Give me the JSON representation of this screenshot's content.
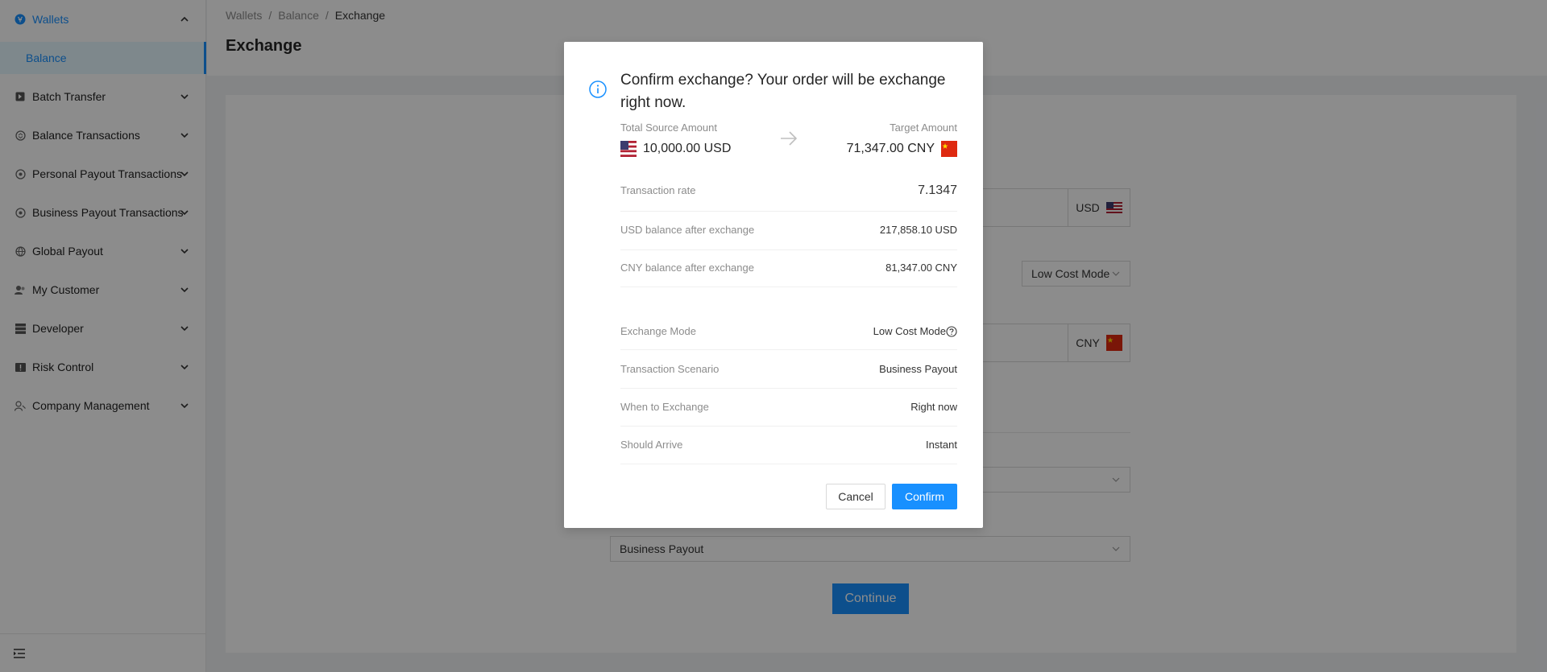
{
  "sidebar": {
    "items": [
      {
        "label": "Wallets",
        "icon": "wallet-icon",
        "expanded": true
      },
      {
        "label": "Batch Transfer",
        "icon": "batch-transfer-icon"
      },
      {
        "label": "Balance Transactions",
        "icon": "balance-transactions-icon"
      },
      {
        "label": "Personal Payout Transactions",
        "icon": "personal-payout-icon"
      },
      {
        "label": "Business Payout Transactions",
        "icon": "business-payout-icon"
      },
      {
        "label": "Global Payout",
        "icon": "global-payout-icon"
      },
      {
        "label": "My Customer",
        "icon": "customer-icon"
      },
      {
        "label": "Developer",
        "icon": "developer-icon"
      },
      {
        "label": "Risk Control",
        "icon": "risk-control-icon"
      },
      {
        "label": "Company Management",
        "icon": "company-icon"
      }
    ],
    "subitem": {
      "label": "Balance"
    },
    "footer_icon": "menu-fold-icon"
  },
  "breadcrumb": {
    "items": [
      "Wallets",
      "Balance",
      "Exchange"
    ],
    "separator": "/"
  },
  "page": {
    "title": "Exchange"
  },
  "form": {
    "source_currency": "USD",
    "target_currency": "CNY",
    "mode_select": "Low Cost Mode",
    "scenario_select": "Business Payout",
    "continue_label": "Continue"
  },
  "modal": {
    "title": "Confirm exchange? Your order will be exchange right now.",
    "source_label": "Total Source Amount",
    "source_amount": "10,000.00 USD",
    "target_label": "Target Amount",
    "target_amount": "71,347.00 CNY",
    "rows": [
      {
        "label": "Transaction rate",
        "value": "7.1347"
      },
      {
        "label": "USD balance after exchange",
        "value": "217,858.10 USD"
      },
      {
        "label": "CNY balance after exchange",
        "value": "81,347.00 CNY"
      },
      {
        "label": "Exchange Mode",
        "value": "Low Cost Mode"
      },
      {
        "label": "Transaction Scenario",
        "value": "Business Payout"
      },
      {
        "label": "When to Exchange",
        "value": "Right now"
      },
      {
        "label": "Should Arrive",
        "value": "Instant"
      }
    ],
    "cancel_label": "Cancel",
    "confirm_label": "Confirm"
  },
  "colors": {
    "primary": "#1890ff",
    "mask": "rgba(0,0,0,0.45)",
    "selected_bg": "#e6f7ff"
  }
}
